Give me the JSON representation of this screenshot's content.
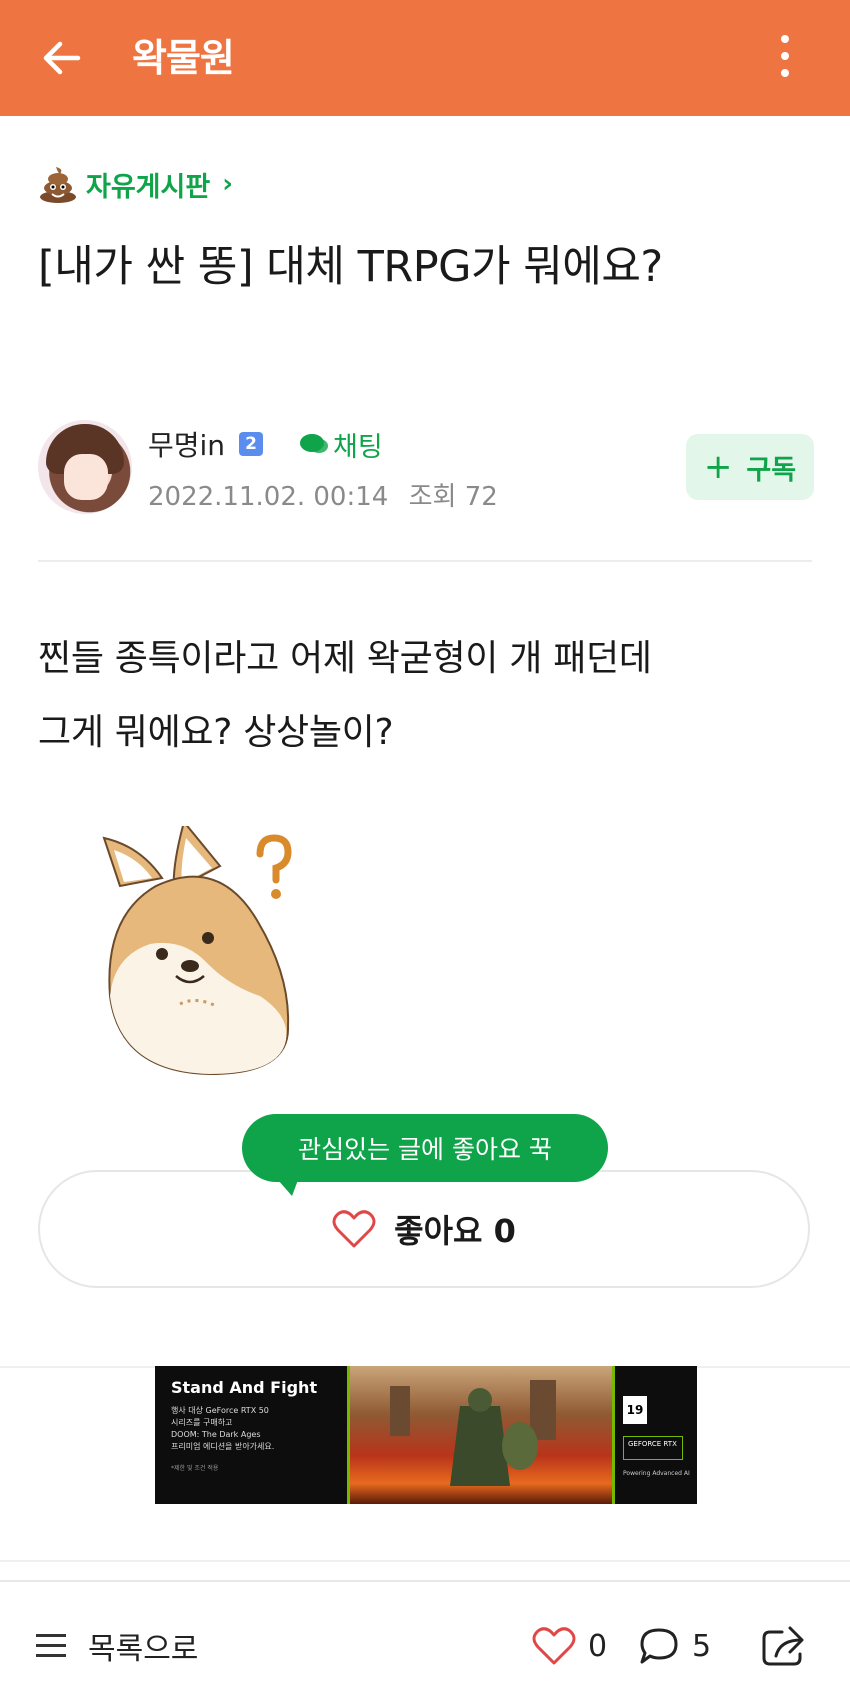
{
  "appbar": {
    "title": "왁물원",
    "back_icon": "arrow-left-icon",
    "more_icon": "more-vertical-icon",
    "color": "#ee7542"
  },
  "post": {
    "board": "자유게시판",
    "title": "[내가 싼 똥] 대체 TRPG가 뭐에요?",
    "author": "무명in",
    "level": "2",
    "chat_label": "채팅",
    "date": "2022.11.02. 00:14",
    "views": "조회 72",
    "subscribe_label": "구독",
    "body_lines": [
      "찐들 종특이라고 어제 왁굳형이 개 패던데",
      "그게 뭐에요? 상상놀이?"
    ]
  },
  "like": {
    "tooltip": "관심있는 글에 좋아요 꾹",
    "label": "좋아요 0"
  },
  "ad": {
    "headline": "Stand And Fight",
    "lines": [
      "행사 대상 GeForce RTX 50",
      "시리즈를 구매하고",
      "DOOM: The Dark Ages",
      "프리미엄 에디션을 받아가세요."
    ],
    "note": "*제한 및 조건 적용",
    "rating": "19",
    "brand": "GEFORCE RTX",
    "brand_sub": "Powering Advanced AI"
  },
  "bottom": {
    "list_label": "목록으로",
    "likes": "0",
    "comments": "5"
  },
  "colors": {
    "accent": "#0fa44a",
    "appbar": "#ee7542"
  }
}
